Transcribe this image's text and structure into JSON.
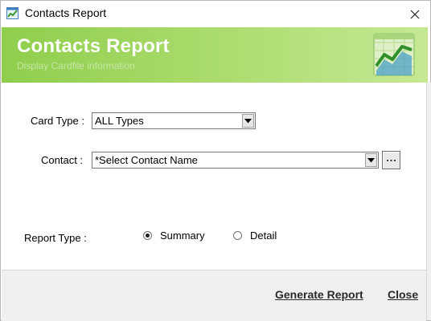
{
  "window": {
    "title": "Contacts Report",
    "icon": "report-chart-icon",
    "close_icon": "close-icon"
  },
  "banner": {
    "heading": "Contacts Report",
    "subheading": "Display Cardfile information",
    "graphic": "report-chart-icon",
    "colors": {
      "start": "#8fce4c",
      "end": "#c6e893"
    }
  },
  "form": {
    "card_type": {
      "label": "Card Type :",
      "selected": "ALL Types"
    },
    "contact": {
      "label": "Contact :",
      "selected": "*Select Contact Name",
      "browse_icon": "ellipsis-icon"
    },
    "report_type": {
      "label": "Report Type :",
      "options": [
        {
          "label": "Summary",
          "checked": true
        },
        {
          "label": "Detail",
          "checked": false
        }
      ]
    }
  },
  "footer": {
    "generate_label": "Generate Report",
    "close_label": "Close"
  }
}
